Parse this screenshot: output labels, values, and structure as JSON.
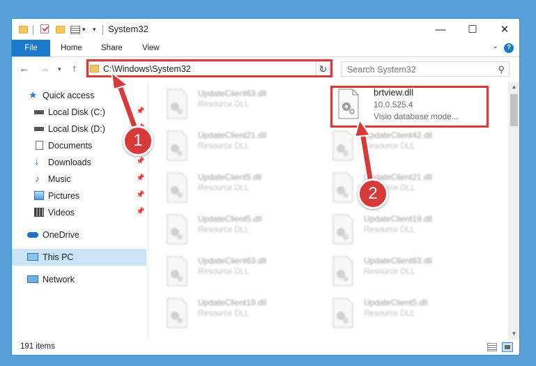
{
  "window": {
    "title": "System32",
    "controls": {
      "minimize": "—",
      "maximize": "☐",
      "close": "✕"
    }
  },
  "ribbon": {
    "tabs": [
      {
        "label": "File"
      },
      {
        "label": "Home"
      },
      {
        "label": "Share"
      },
      {
        "label": "View"
      }
    ]
  },
  "address_bar": {
    "path": "C:\\Windows\\System32"
  },
  "search": {
    "placeholder": "Search System32"
  },
  "sidebar": {
    "items": [
      {
        "label": "Quick access",
        "icon": "star-icon"
      },
      {
        "label": "Local Disk (C:)",
        "icon": "drive-icon",
        "pinned": true
      },
      {
        "label": "Local Disk (D:)",
        "icon": "drive-icon",
        "pinned": true
      },
      {
        "label": "Documents",
        "icon": "document-icon",
        "pinned": true
      },
      {
        "label": "Downloads",
        "icon": "download-icon",
        "pinned": true
      },
      {
        "label": "Music",
        "icon": "music-icon",
        "pinned": true
      },
      {
        "label": "Pictures",
        "icon": "pictures-icon",
        "pinned": true
      },
      {
        "label": "Videos",
        "icon": "videos-icon",
        "pinned": true
      },
      {
        "label": "OneDrive",
        "icon": "cloud-icon"
      },
      {
        "label": "This PC",
        "icon": "computer-icon",
        "selected": true
      },
      {
        "label": "Network",
        "icon": "network-icon"
      }
    ]
  },
  "files": {
    "featured": {
      "name": "brtview.dll",
      "version": "10.0.525.4",
      "description": "Visio database mode..."
    },
    "left_column": [
      {
        "name": "UpdateClient63.dll",
        "type": "Resource DLL"
      },
      {
        "name": "UpdateClient21.dll",
        "type": "Resource DLL"
      },
      {
        "name": "UpdateClient5.dll",
        "type": "Resource DLL"
      },
      {
        "name": "UpdateClient5.dll",
        "type": "Resource DLL"
      },
      {
        "name": "UpdateClient63.dll",
        "type": "Resource DLL"
      },
      {
        "name": "UpdateClient19.dll",
        "type": "Resource DLL"
      }
    ],
    "right_column": [
      {
        "name": "UpdateClient42.dll",
        "type": "Resource DLL"
      },
      {
        "name": "UpdateClient21.dll",
        "type": "Resource DLL"
      },
      {
        "name": "UpdateClient19.dll",
        "type": "Resource DLL"
      },
      {
        "name": "UpdateClient63.dll",
        "type": "Resource DLL"
      },
      {
        "name": "UpdateClient5.dll",
        "type": "Resource DLL"
      }
    ]
  },
  "status": {
    "item_count": "191 items"
  },
  "annotations": {
    "step1": "1",
    "step2": "2",
    "color": "#d83a3a"
  }
}
